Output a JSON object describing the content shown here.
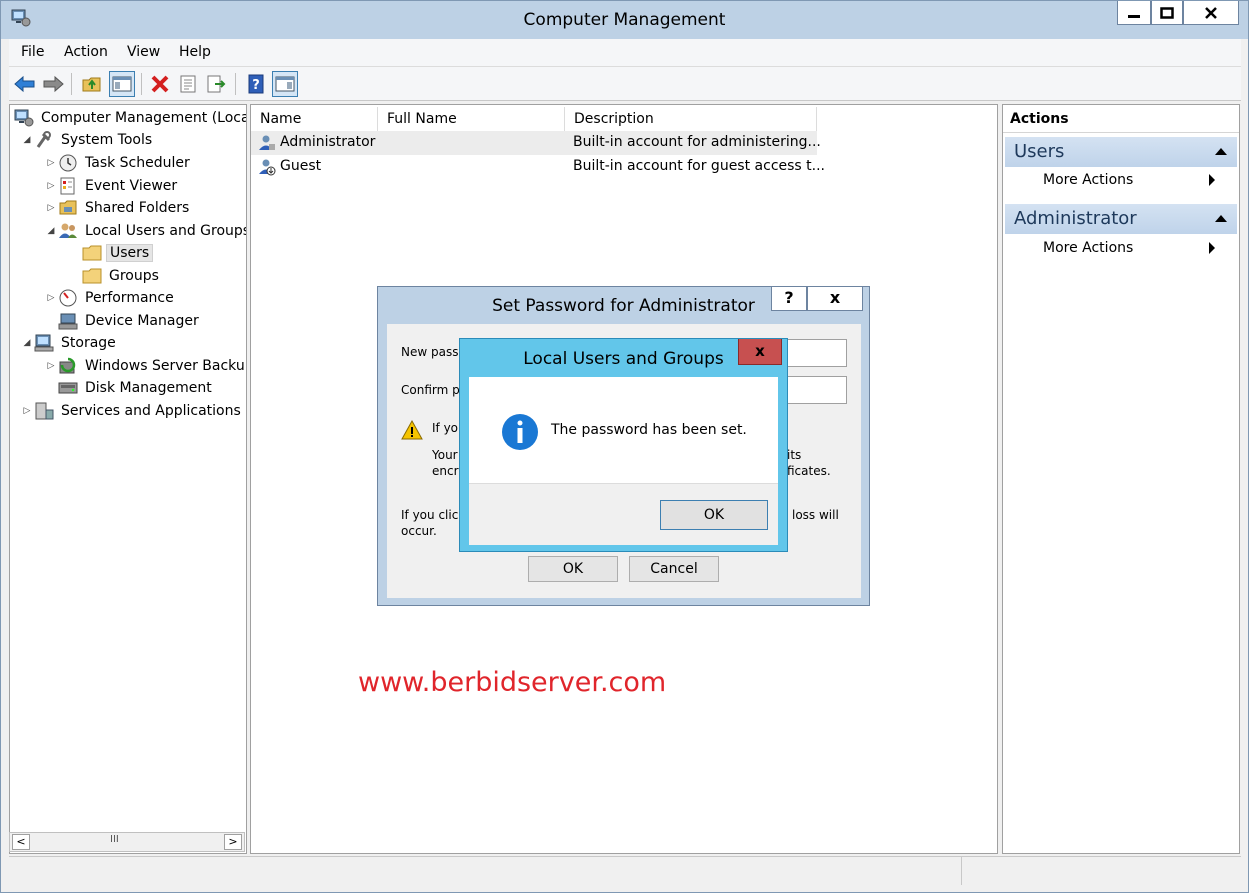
{
  "window": {
    "title": "Computer Management"
  },
  "menu": [
    "File",
    "Action",
    "View",
    "Help"
  ],
  "tree": {
    "items": [
      {
        "label": "Computer Management (Local",
        "arrow": "",
        "level": 0
      },
      {
        "label": "System Tools",
        "arrow": "◢",
        "level": 1
      },
      {
        "label": "Task Scheduler",
        "arrow": "▷",
        "level": 2
      },
      {
        "label": "Event Viewer",
        "arrow": "▷",
        "level": 2
      },
      {
        "label": "Shared Folders",
        "arrow": "▷",
        "level": 2
      },
      {
        "label": "Local Users and Groups",
        "arrow": "◢",
        "level": 2
      },
      {
        "label": "Users",
        "arrow": "",
        "level": 3,
        "selected": true
      },
      {
        "label": "Groups",
        "arrow": "",
        "level": 3
      },
      {
        "label": "Performance",
        "arrow": "▷",
        "level": 2
      },
      {
        "label": "Device Manager",
        "arrow": "",
        "level": 2
      },
      {
        "label": "Storage",
        "arrow": "◢",
        "level": 1
      },
      {
        "label": "Windows Server Backup",
        "arrow": "▷",
        "level": 2
      },
      {
        "label": "Disk Management",
        "arrow": "",
        "level": 2
      },
      {
        "label": "Services and Applications",
        "arrow": "▷",
        "level": 1
      }
    ],
    "scroll_thumb": "III"
  },
  "list": {
    "columns": [
      "Name",
      "Full Name",
      "Description"
    ],
    "rows": [
      {
        "name": "Administrator",
        "full_name": "",
        "description": "Built-in account for administering..."
      },
      {
        "name": "Guest",
        "full_name": "",
        "description": "Built-in account for guest access t..."
      }
    ]
  },
  "actions": {
    "title": "Actions",
    "sections": [
      {
        "title": "Users",
        "item": "More Actions"
      },
      {
        "title": "Administrator",
        "item": "More Actions"
      }
    ]
  },
  "set_password_dialog": {
    "title": "Set Password for Administrator",
    "help": "?",
    "close": "x",
    "new_password_label": "New pass",
    "confirm_password_label": "Confirm pa",
    "warning_line1": "If you",
    "warning_line2a": "Your",
    "warning_line2b": "its",
    "warning_line3a": "encry",
    "warning_line3b": "ficates.",
    "note_line1a": "If you click",
    "note_line1b": "loss will",
    "note_line2": "occur.",
    "ok": "OK",
    "cancel": "Cancel"
  },
  "info_dialog": {
    "title": "Local Users and Groups",
    "close": "x",
    "message": "The password has been set.",
    "ok": "OK"
  },
  "watermark": "www.berbidserver.com"
}
